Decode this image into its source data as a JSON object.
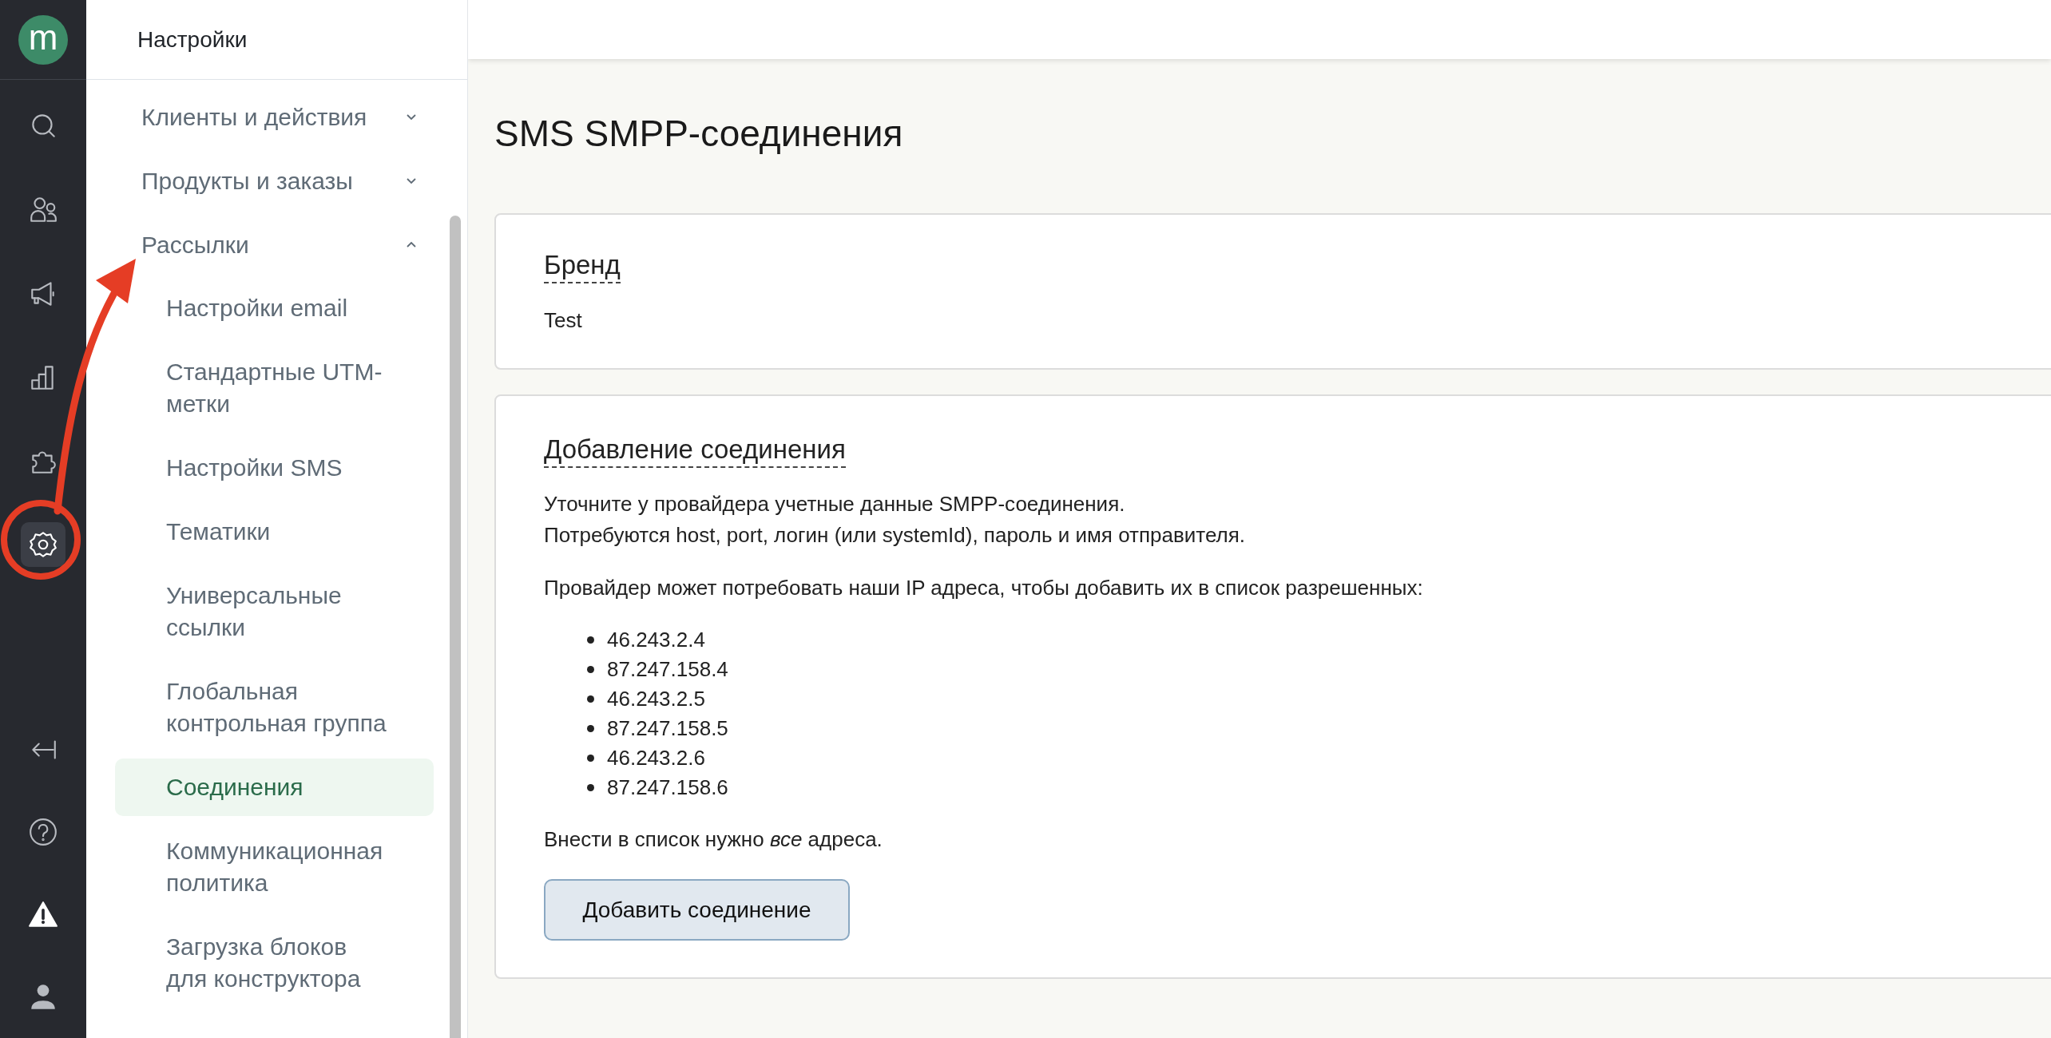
{
  "logo": {
    "text": "m"
  },
  "rail": {
    "top_items": [
      {
        "kind": "search",
        "selected": false
      },
      {
        "kind": "people",
        "selected": false
      },
      {
        "kind": "megaphone",
        "selected": false
      },
      {
        "kind": "chart",
        "selected": false
      },
      {
        "kind": "puzzle",
        "selected": false
      },
      {
        "kind": "gear",
        "selected": true
      }
    ],
    "bottom_items": [
      {
        "kind": "collapse",
        "selected": false
      },
      {
        "kind": "help",
        "selected": false
      },
      {
        "kind": "warning",
        "selected": false
      },
      {
        "kind": "user",
        "selected": false
      }
    ]
  },
  "sidebar": {
    "title": "Настройки",
    "sections": [
      {
        "label": "Клиенты и действия",
        "expanded": false
      },
      {
        "label": "Продукты и заказы",
        "expanded": false
      },
      {
        "label": "Рассылки",
        "expanded": true,
        "children": [
          {
            "label": "Настройки email",
            "selected": false
          },
          {
            "label": "Стандартные UTM-метки",
            "selected": false
          },
          {
            "label": "Настройки SMS",
            "selected": false
          },
          {
            "label": "Тематики",
            "selected": false
          },
          {
            "label": "Универсальные ссылки",
            "selected": false
          },
          {
            "label": "Глобальная контрольная группа",
            "selected": false
          },
          {
            "label": "Соединения",
            "selected": true
          },
          {
            "label": "Коммуникационная политика",
            "selected": false
          },
          {
            "label": "Загрузка блоков для конструктора",
            "selected": false
          }
        ]
      }
    ]
  },
  "page": {
    "title": "SMS SMPP-соединения",
    "brand_card": {
      "heading": "Бренд",
      "value": "Test"
    },
    "connection_card": {
      "heading": "Добавление соединения",
      "intro_lines": [
        "Уточните у провайдера учетные данные SMPP-соединения.",
        "Потребуются host, port, логин (или systemId), пароль и имя отправителя."
      ],
      "ip_intro": "Провайдер может потребовать наши IP адреса, чтобы добавить их в список разрешенных:",
      "ip_addresses": [
        "46.243.2.4",
        "87.247.158.4",
        "46.243.2.5",
        "87.247.158.5",
        "46.243.2.6",
        "87.247.158.6"
      ],
      "note": "Внести в список нужно *все* адреса.",
      "button": "Добавить соединение"
    }
  }
}
